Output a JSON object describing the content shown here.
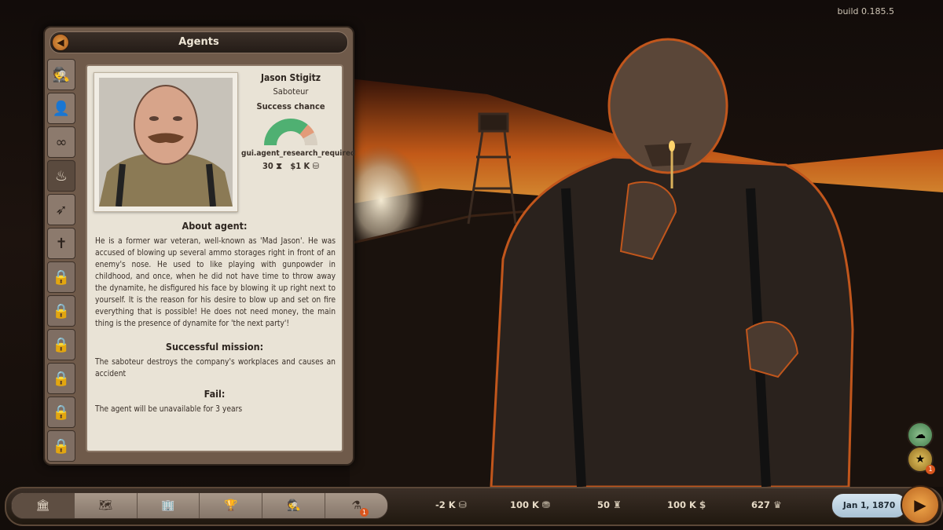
{
  "build": "build 0.185.5",
  "panel": {
    "title": "Agents",
    "tabs": [
      {
        "name": "spy-tab",
        "icon": "spy-icon"
      },
      {
        "name": "detective-tab",
        "icon": "detective-icon"
      },
      {
        "name": "binoculars-tab",
        "icon": "binoculars-icon"
      },
      {
        "name": "saboteur-tab",
        "icon": "fire-icon",
        "active": true
      },
      {
        "name": "thief-tab",
        "icon": "runner-icon"
      },
      {
        "name": "preacher-tab",
        "icon": "bible-icon"
      },
      {
        "name": "locked-tab",
        "icon": "lock-icon"
      },
      {
        "name": "locked-tab",
        "icon": "lock-icon"
      },
      {
        "name": "locked-tab",
        "icon": "lock-icon"
      },
      {
        "name": "locked-tab",
        "icon": "lock-icon"
      },
      {
        "name": "locked-tab",
        "icon": "lock-icon"
      },
      {
        "name": "locked-tab",
        "icon": "lock-icon"
      }
    ]
  },
  "agent": {
    "name": "Jason Stigitz",
    "role": "Saboteur",
    "success_label": "Success chance",
    "research_required": "gui.agent_research_required",
    "time_cost": "30",
    "money_cost": "$1 K",
    "success_chance": 0.72
  },
  "about": {
    "heading": "About agent:",
    "text": "He is a former war veteran, well-known as  'Mad Jason'.  He was accused of blowing up several ammo storages right in front of an enemy's nose. He used to like playing with gunpowder in childhood, and once, when he did not have time to throw away the dynamite, he disfigured his face by blowing it up right next to yourself. It is the reason for his desire to blow up and set on fire everything that is possible! He does not need money, the main thing is the presence of dynamite for 'the next party'!"
  },
  "success": {
    "heading": "Successful mission:",
    "text": "The saboteur destroys the company's workplaces and causes an accident"
  },
  "fail": {
    "heading": "Fail:",
    "text": "The agent will be unavailable for 3 years"
  },
  "bottom": {
    "stats": {
      "income": "-2 K",
      "coins": "100 K",
      "hats": "50",
      "dollars": "100 K",
      "prestige": "627"
    },
    "date": "Jan 1, 1870",
    "nav_badge": "1",
    "side_badge": "1"
  }
}
